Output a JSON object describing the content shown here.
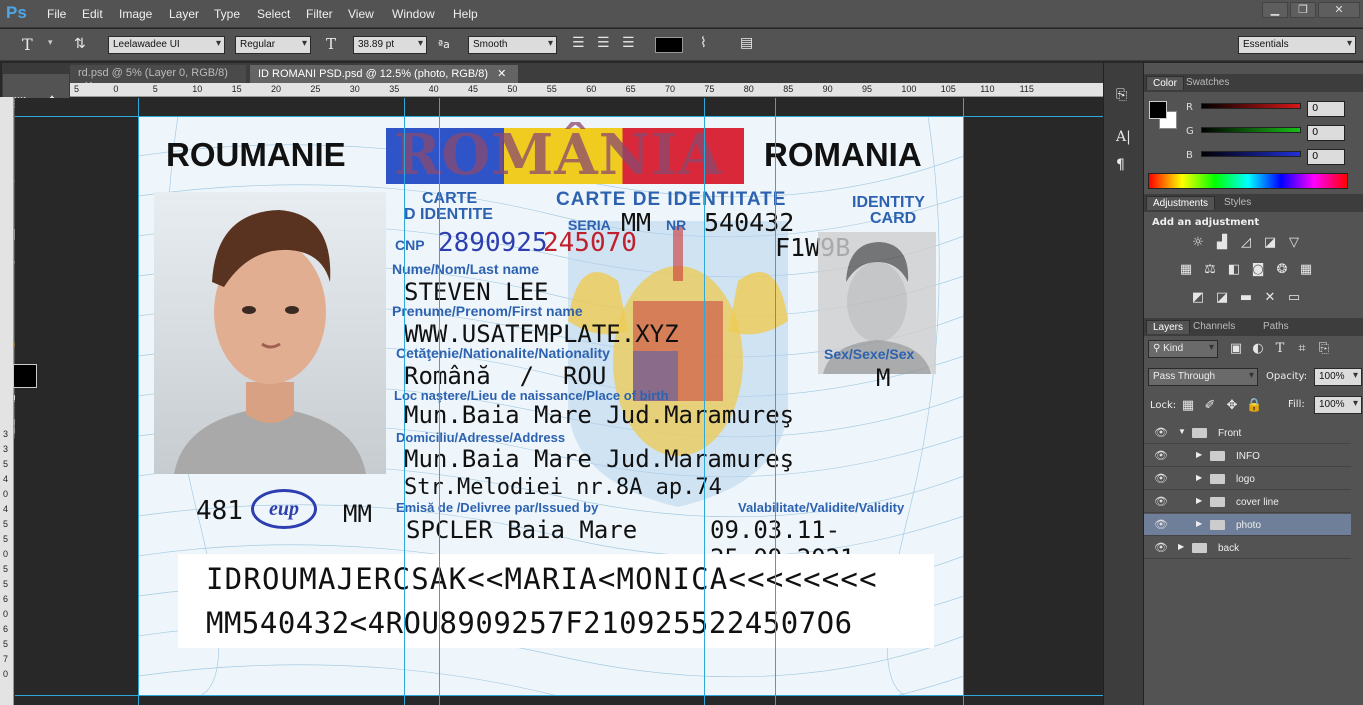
{
  "app": {
    "logo": "Ps"
  },
  "menu": [
    "File",
    "Edit",
    "Image",
    "Layer",
    "Type",
    "Select",
    "Filter",
    "View",
    "Window",
    "Help"
  ],
  "window_controls": {
    "min": "▁",
    "restore": "❐",
    "close": "✕"
  },
  "options": {
    "font_family": "Leelawadee UI",
    "font_style": "Regular",
    "font_size": "38.89 pt",
    "anti_alias_label": "ªa",
    "anti_alias": "Smooth",
    "color_swatch": "#000000",
    "workspace": "Essentials"
  },
  "tabs": [
    {
      "label": "rd.psd @ 5% (Layer 0, RGB/8)",
      "close": "✕"
    },
    {
      "label": "ID ROMANI PSD.psd @ 12.5% (photo, RGB/8)",
      "close": "✕"
    }
  ],
  "ruler_h": [
    "5",
    "0",
    "5",
    "10",
    "15",
    "20",
    "25",
    "30",
    "35",
    "40",
    "45",
    "50",
    "55",
    "60",
    "65",
    "70",
    "75",
    "80",
    "85",
    "90",
    "95",
    "100",
    "105",
    "110",
    "115"
  ],
  "ruler_v": [
    "3",
    "3",
    "5",
    "4",
    "0",
    "4",
    "5",
    "5",
    "0",
    "5",
    "5",
    "6",
    "0",
    "6",
    "5",
    "7",
    "0"
  ],
  "card": {
    "country_fr": "ROUMANIE",
    "country_ro": "ROMÂNIA",
    "country_en": "ROMANIA",
    "carte_fr_line1": "CARTE",
    "carte_fr_line2": "D IDENTITE",
    "carte_ro": "CARTE DE IDENTITATE",
    "identity_card_line1": "IDENTITY",
    "identity_card_line2": "CARD",
    "seria_label": "SERIA",
    "seria": "MM",
    "nr_label": "NR",
    "number": "540432",
    "code": "F1W9B",
    "cnp_label": "CNP",
    "cnp_part1": "2890925",
    "cnp_part2": "245070",
    "name_label": "Nume/Nom/Last name",
    "name": "STEVEN LEE",
    "firstname_label": "Prenume/Prenom/First name",
    "firstname": "WWW.USATEMPLATE.XYZ",
    "nationality_label": "Cetăţenie/Nationalite/Nationality",
    "nationality": "Română  /  ROU",
    "sex_label": "Sex/Sexe/Sex",
    "sex": "M",
    "birth_label": "Loc naştere/Lieu de naissance/Place of birth",
    "birth": "Mun.Baia Mare Jud.Maramureş",
    "address_label": "Domiciliu/Adresse/Address",
    "address1": "Mun.Baia Mare Jud.Maramureş",
    "address2": "Str.Melodiei nr.8A ap.74",
    "issued_label": "Emisă de /Delivree par/Issued by",
    "issued": "SPCLER Baia Mare",
    "validity_label": "Valabilitate/Validite/Validity",
    "validity": "09.03.11-25.09.2021",
    "stamp_left": "481",
    "stamp_logo": "eup",
    "stamp_right": "MM",
    "mrz1": "IDROUMAJERCSAK<<MARIA<MONICA<<<<<<<<",
    "mrz2": "MM540432<4ROU8909257F2109255224507O6"
  },
  "panels": {
    "color_tabs": [
      "Color",
      "Swatches"
    ],
    "rgb": [
      {
        "label": "R",
        "value": "0",
        "color": "#d81818"
      },
      {
        "label": "G",
        "value": "0",
        "color": "#18c018"
      },
      {
        "label": "B",
        "value": "0",
        "color": "#2030d8"
      }
    ],
    "adj_tabs": [
      "Adjustments",
      "Styles"
    ],
    "adj_title": "Add an adjustment",
    "layer_tabs": [
      "Layers",
      "Channels",
      "Paths"
    ],
    "kind": "Kind",
    "blend": "Pass Through",
    "opacity_label": "Opacity:",
    "opacity": "100%",
    "lock_label": "Lock:",
    "fill_label": "Fill:",
    "fill": "100%",
    "layers": [
      {
        "name": "Front",
        "indent": 0,
        "open": true,
        "selected": false
      },
      {
        "name": "INFO",
        "indent": 1,
        "open": false,
        "selected": false
      },
      {
        "name": "logo",
        "indent": 1,
        "open": false,
        "selected": false
      },
      {
        "name": "cover line",
        "indent": 1,
        "open": false,
        "selected": false
      },
      {
        "name": "photo",
        "indent": 1,
        "open": false,
        "selected": true
      },
      {
        "name": "back",
        "indent": 0,
        "open": false,
        "selected": false
      }
    ]
  }
}
